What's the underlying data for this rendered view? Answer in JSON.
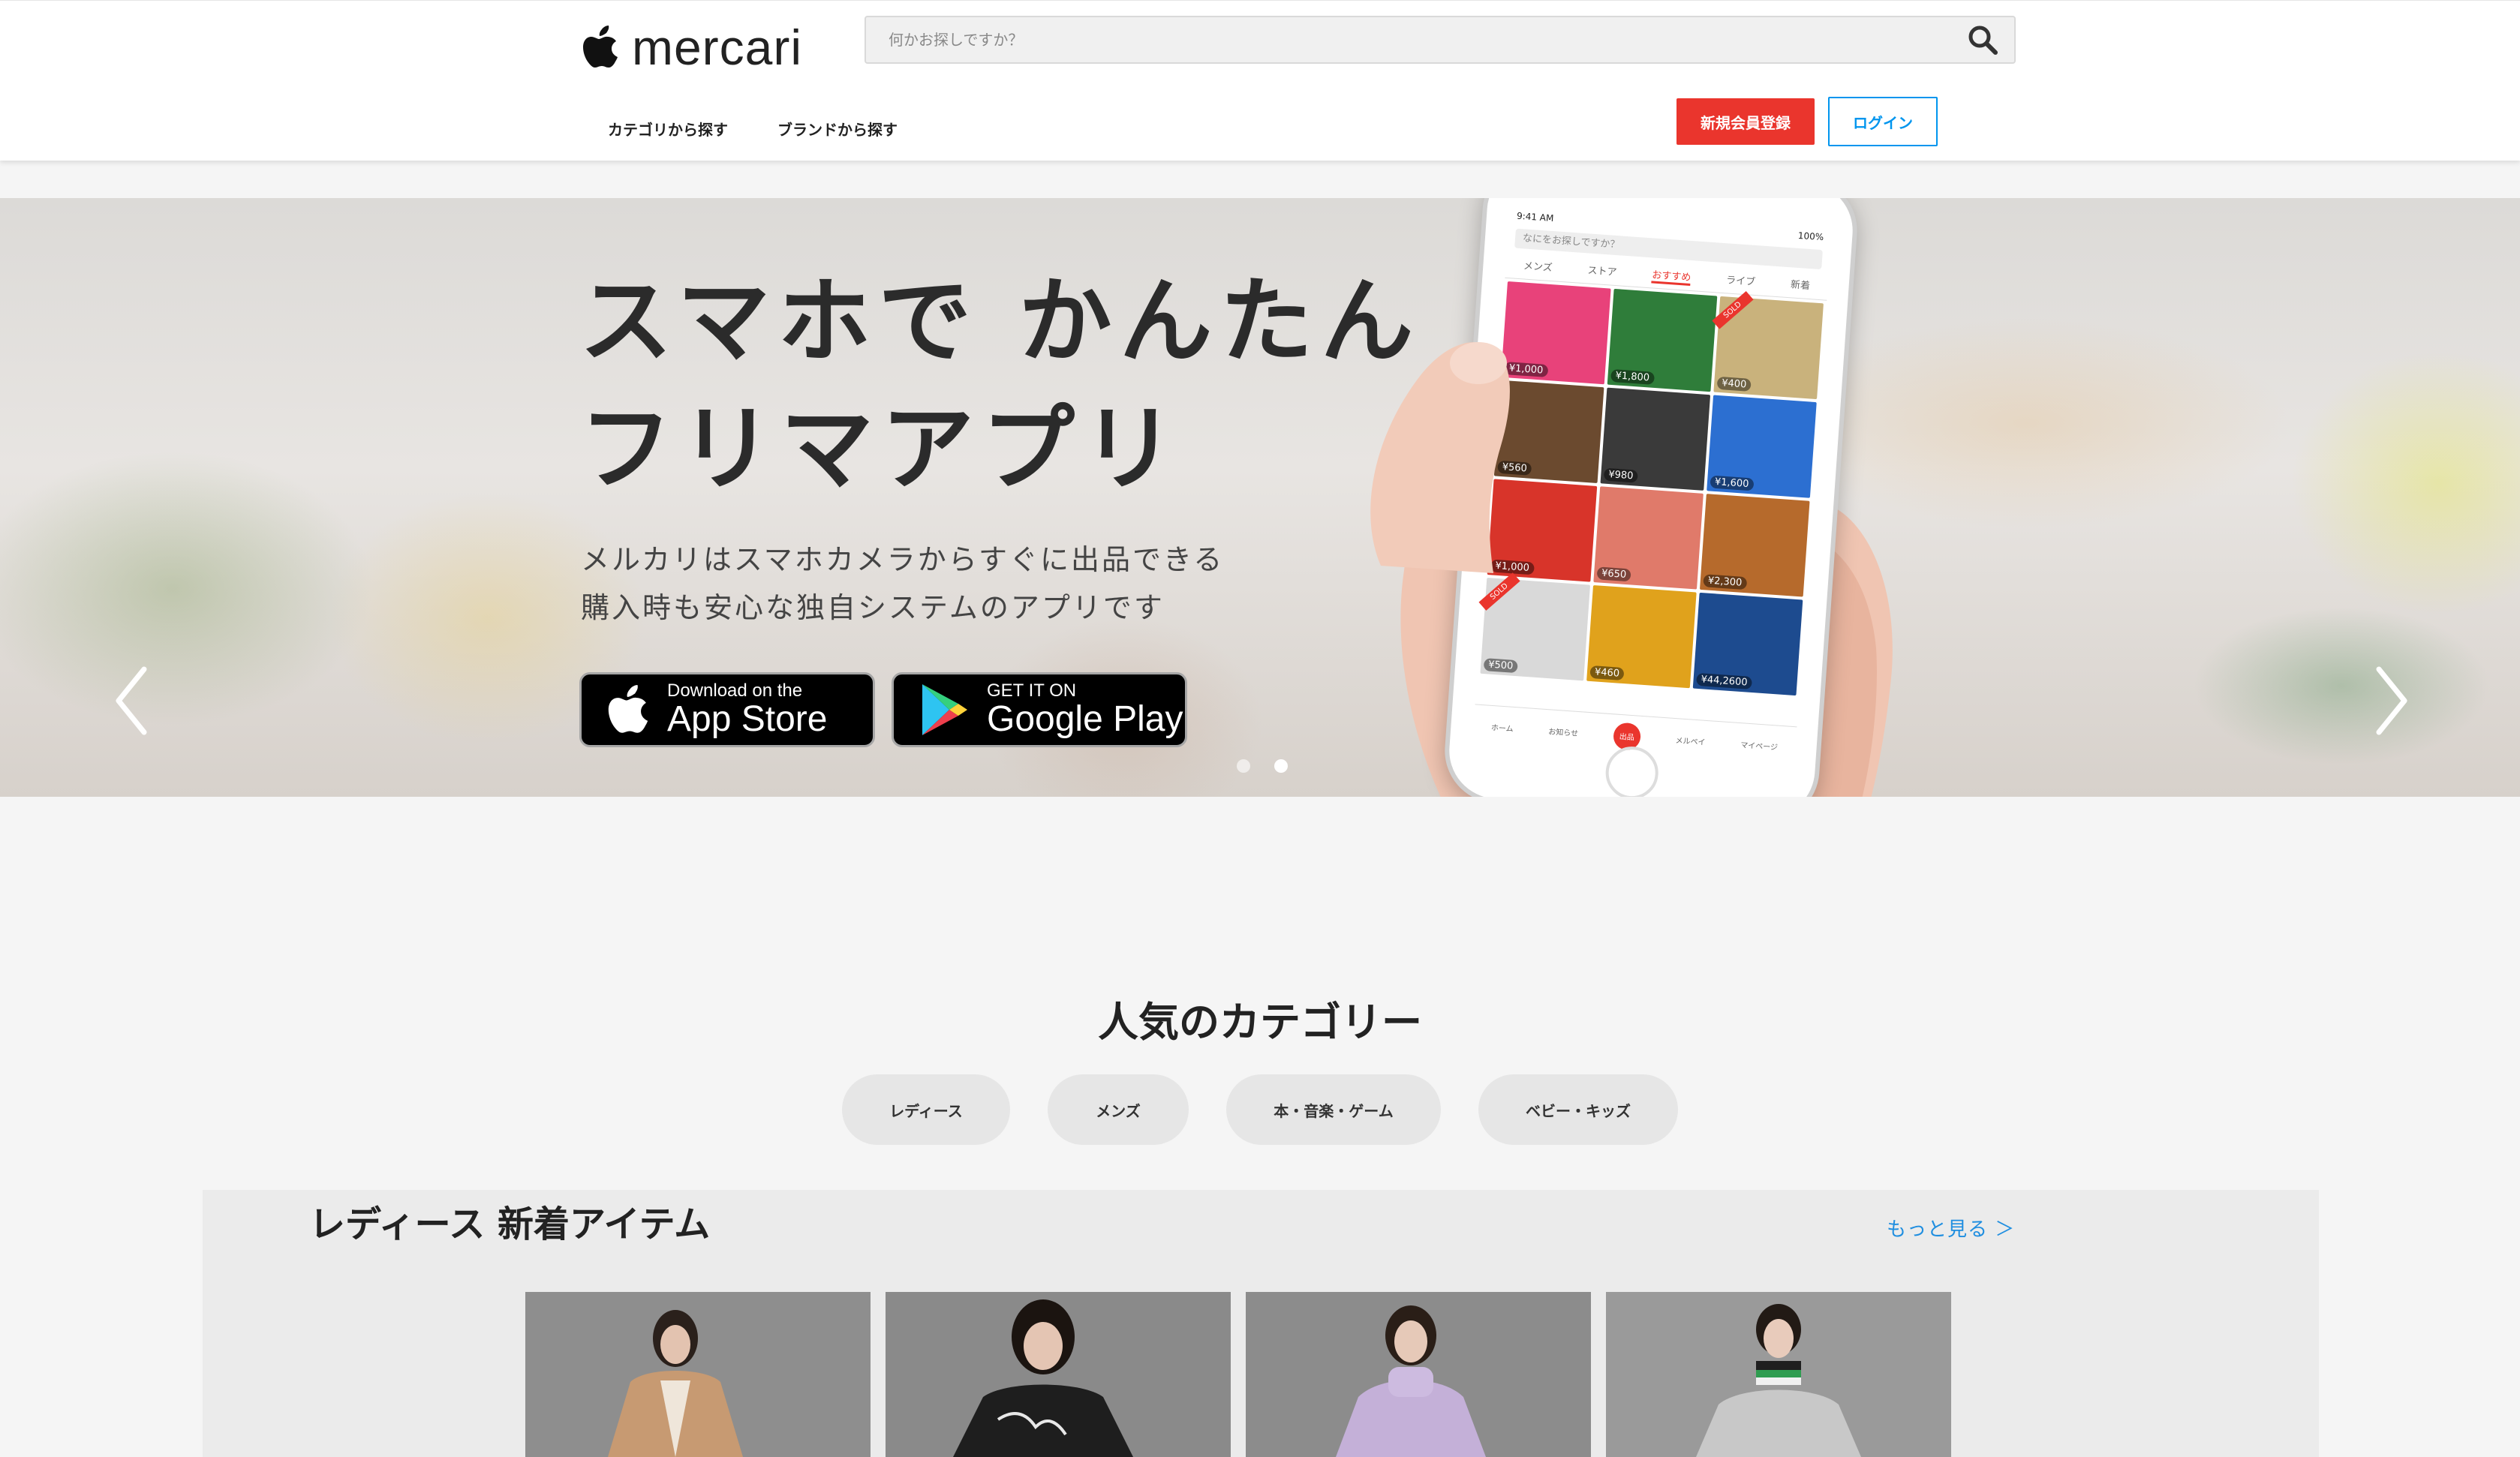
{
  "header": {
    "logo_text": "mercari",
    "search_placeholder": "何かお探しですか？",
    "nav": [
      "カテゴリから探す",
      "ブランドから探す"
    ],
    "signup_label": "新規会員登録",
    "login_label": "ログイン"
  },
  "hero": {
    "title_line1": "スマホで かんたん",
    "title_line2": "フリマアプリ",
    "sub_line1": "メルカリはスマホカメラからすぐに出品できる",
    "sub_line2": "購入時も安心な独自システムのアプリです",
    "appstore_small": "Download on the",
    "appstore_big": "App Store",
    "google_small": "GET IT ON",
    "google_big": "Google Play",
    "active_slide": 2,
    "slide_count": 2
  },
  "phone": {
    "time": "9:41 AM",
    "battery": "100%",
    "search_placeholder": "なにをお探しですか？",
    "tabs": [
      "メンズ",
      "ストア",
      "おすすめ",
      "ライブ",
      "新着"
    ],
    "active_tab": "おすすめ",
    "items": [
      {
        "price": "¥1,000",
        "color": "#e8427a"
      },
      {
        "price": "¥1,800",
        "color": "#2f7d3a"
      },
      {
        "price": "¥400",
        "color": "#c9b27c",
        "sold": true
      },
      {
        "price": "¥560",
        "color": "#6b4a2f"
      },
      {
        "price": "¥980",
        "color": "#3a3a3a"
      },
      {
        "price": "¥1,600",
        "color": "#2c6fd1"
      },
      {
        "price": "¥1,000",
        "color": "#d8342a"
      },
      {
        "price": "¥650",
        "color": "#e07a6a"
      },
      {
        "price": "¥2,300",
        "color": "#b66a2c"
      },
      {
        "price": "¥500",
        "color": "#d9d9d9",
        "sold": true
      },
      {
        "price": "¥460",
        "color": "#e0a21c"
      },
      {
        "price": "¥44,2600",
        "color": "#1d4b8f"
      }
    ],
    "sold_label": "SOLD",
    "nav": [
      "ホーム",
      "お知らせ",
      "出品",
      "メルペイ",
      "マイページ"
    ]
  },
  "categories": {
    "title": "人気のカテゴリー",
    "items": [
      "レディース",
      "メンズ",
      "本・音楽・ゲーム",
      "ベビー・キッズ"
    ]
  },
  "new_items": {
    "title": "レディース 新着アイテム",
    "more_label": "もっと見る ＞",
    "cards": [
      {
        "bg": "#8e8e8e",
        "garment": "#c79a72"
      },
      {
        "bg": "#8a8a8a",
        "garment": "#1e1e1e"
      },
      {
        "bg": "#8c8c8c",
        "garment": "#c4b0d8"
      },
      {
        "bg": "#9a9a9a",
        "garment": "#c8c8c8"
      }
    ]
  },
  "colors": {
    "accent_red": "#ea352d",
    "accent_blue": "#0095ee",
    "link_blue": "#1f8ee0"
  }
}
